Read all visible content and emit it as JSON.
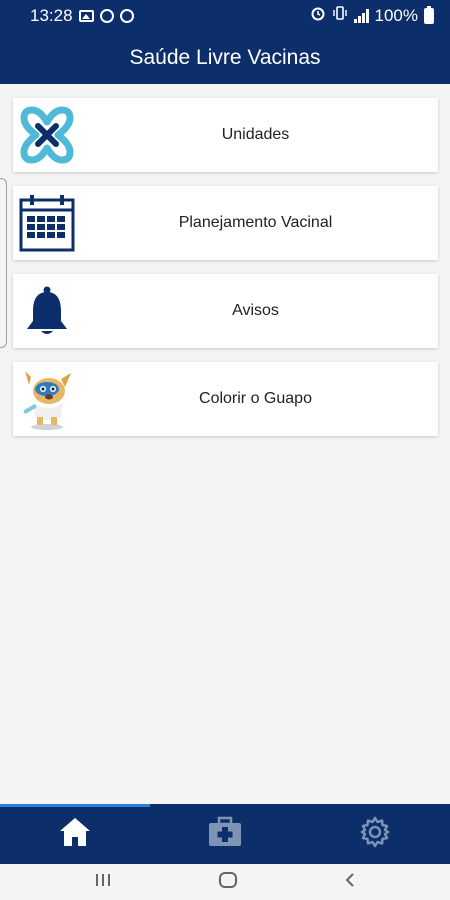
{
  "status_bar": {
    "time": "13:28",
    "battery_text": "100%",
    "icons": [
      "image-icon",
      "whatsapp-icon",
      "sync-icon",
      "alarm-icon",
      "vibrate-icon",
      "signal-icon",
      "battery-icon"
    ]
  },
  "header": {
    "title": "Saúde Livre Vacinas"
  },
  "menu": {
    "items": [
      {
        "label": "Unidades",
        "icon": "logo-icon"
      },
      {
        "label": "Planejamento Vacinal",
        "icon": "calendar-icon"
      },
      {
        "label": "Avisos",
        "icon": "bell-icon"
      },
      {
        "label": "Colorir o Guapo",
        "icon": "mascot-icon"
      }
    ]
  },
  "tabbar": {
    "tabs": [
      {
        "name": "home",
        "icon": "home-icon",
        "active": true
      },
      {
        "name": "medical-kit",
        "icon": "medical-kit-icon",
        "active": false
      },
      {
        "name": "settings",
        "icon": "gear-icon",
        "active": false
      }
    ]
  },
  "colors": {
    "primary": "#0c2f6b",
    "background": "#f4f4f5",
    "indicator": "#2a7fd6",
    "logo_teal": "#4fb9d8"
  }
}
